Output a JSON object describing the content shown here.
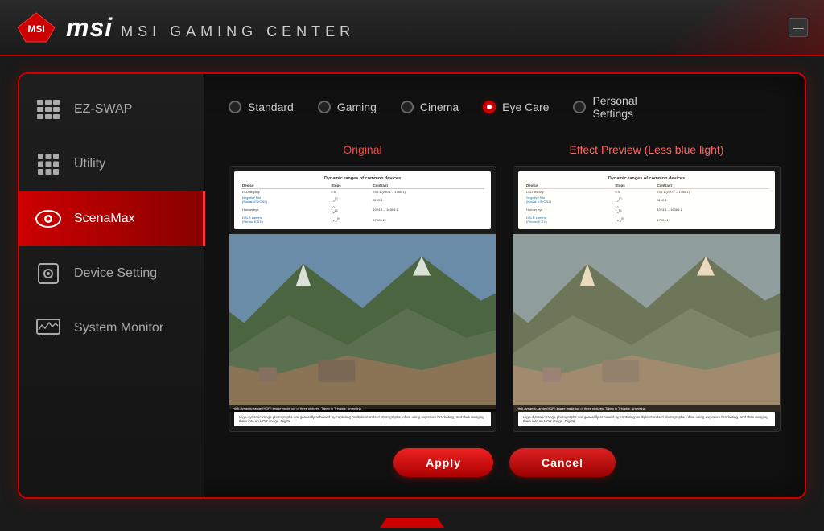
{
  "app": {
    "title": "MSI GAMING CENTER",
    "logo_text": "msi",
    "minimize_label": "—"
  },
  "sidebar": {
    "items": [
      {
        "id": "ezswap",
        "label": "EZ-SWAP",
        "icon": "ezswap-icon",
        "active": false
      },
      {
        "id": "utility",
        "label": "Utility",
        "icon": "utility-icon",
        "active": false
      },
      {
        "id": "scenamax",
        "label": "ScenaMax",
        "icon": "eye-icon",
        "active": true
      },
      {
        "id": "device-setting",
        "label": "Device Setting",
        "icon": "device-icon",
        "active": false
      },
      {
        "id": "system-monitor",
        "label": "System Monitor",
        "icon": "sysmon-icon",
        "active": false
      }
    ]
  },
  "modes": [
    {
      "id": "standard",
      "label": "Standard",
      "active": false
    },
    {
      "id": "gaming",
      "label": "Gaming",
      "active": false
    },
    {
      "id": "cinema",
      "label": "Cinema",
      "active": false
    },
    {
      "id": "eye-care",
      "label": "Eye Care",
      "active": true
    },
    {
      "id": "personal",
      "label": "Personal\nSettings",
      "active": false
    }
  ],
  "preview": {
    "original_title": "Original",
    "effect_title": "Effect Preview (Less blue light)",
    "doc_title": "Dynamic ranges of common devices",
    "doc_headers": [
      "Device",
      "Stops",
      "Contrast"
    ],
    "doc_rows": [
      [
        "LCD display",
        "9.5",
        "700:1 (250:1 – 1750:1)"
      ],
      [
        "Negative film\n(Kodak VIS/ON3)",
        "13[7]",
        "8192:1"
      ],
      [
        "Human eye",
        "10–14[8]",
        "1024:1 – 16384:1"
      ],
      [
        "DSLR camera\n(Pentax K-5 II)",
        "14.1[9]",
        "17500:1"
      ]
    ],
    "doc_body": "High-dynamic-range photographs are generally achieved by capturing multiple standard photographs, often using exposure bracketing, and then merging them into an HDR image. Digital",
    "photo_caption": "High-dynamic-range (HDR) image made out of three pictures. Taken in Trinador, Argentina."
  },
  "buttons": {
    "apply_label": "Apply",
    "cancel_label": "Cancel"
  }
}
